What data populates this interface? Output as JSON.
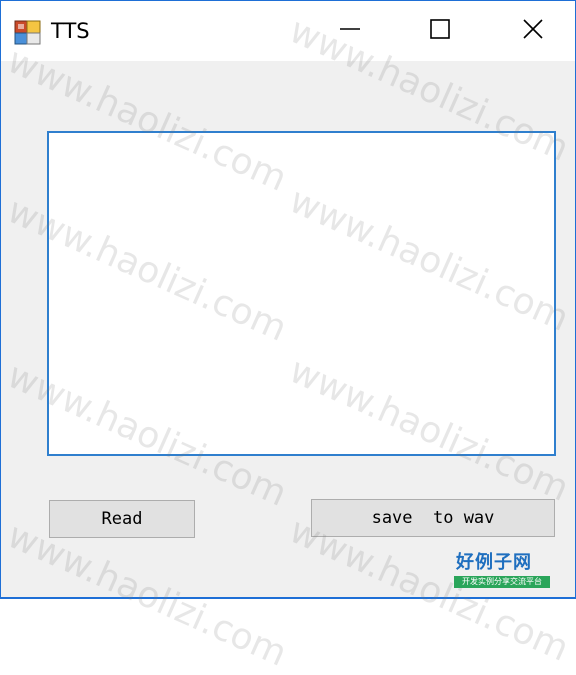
{
  "window": {
    "title": "TTS",
    "icon": "app-window-icon",
    "controls": {
      "minimize": "minimize-icon",
      "maximize": "maximize-icon",
      "close": "close-icon"
    },
    "accent_color": "#1e6fd6"
  },
  "editor": {
    "value": ""
  },
  "buttons": {
    "read_label": "Read",
    "save_label": "save  to wav"
  },
  "watermark": {
    "text": "www.haolizi.com",
    "logo_text": "好例子网",
    "logo_subtext": "开发实例分享交流平台"
  }
}
